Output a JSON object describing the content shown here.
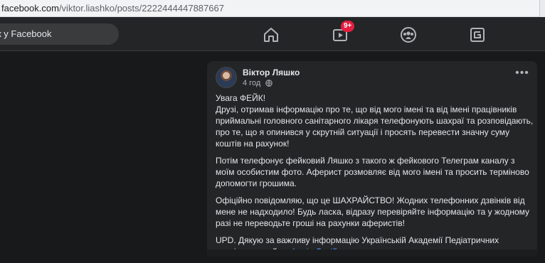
{
  "browser": {
    "url_domain": "facebook.com",
    "url_path": "/viktor.liashko/posts/2222444447887667"
  },
  "header": {
    "search_placeholder": "к у Facebook",
    "icons": [
      "home-icon",
      "watch-icon",
      "groups-icon",
      "gaming-icon"
    ],
    "watch_badge": "9+"
  },
  "post": {
    "author": "Віктор Ляшко",
    "time": "4 год",
    "more": "•••",
    "paragraphs": {
      "p1": [
        "Увага ФЕЙК!",
        "Друзі, отримав інформацію про те, що  від мого імені та від імені працівників",
        "приймальні головного санітарного лікаря телефонують шахраї та розповідають,",
        "про те, що я опинився у скрутній ситуації і просять перевести значну суму",
        "коштів на рахунок!"
      ],
      "p2": [
        "Потім телефонує фейковий Ляшко з такого ж фейкового Телеграм каналу з",
        "моїм особистим фото. Аферист розмовляє від мого імені та просить терміново",
        "допомогти  грошима."
      ],
      "p3": [
        "Офіційно повідомляю, що це ШАХРАЙСТВО! Жодних телефонних дзвінків від",
        "мене не надходило! Будь ласка, відразу перевіряйте інформацію та у жодному",
        "разі не переводьте гроші на рахунки аферистів!"
      ],
      "p4": [
        "UPD. Дякую за важливу інформацію Українській Академії Педіатричних",
        "спеціальностей та "
      ],
      "p4_link": "Федір Лапій"
    }
  }
}
